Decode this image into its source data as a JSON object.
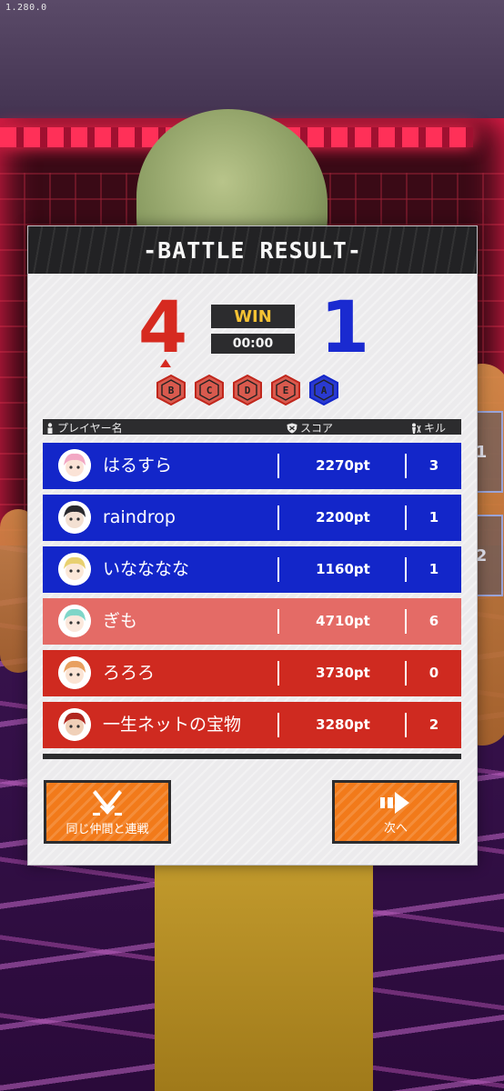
{
  "version": "1.280.0",
  "title": "-BATTLE RESULT-",
  "result": {
    "red_score": "4",
    "blue_score": "1",
    "status": "WIN",
    "time": "00:00"
  },
  "zones": [
    {
      "letter": "B",
      "team": "red"
    },
    {
      "letter": "C",
      "team": "red"
    },
    {
      "letter": "D",
      "team": "red"
    },
    {
      "letter": "E",
      "team": "red"
    },
    {
      "letter": "A",
      "team": "blue"
    }
  ],
  "table_headers": {
    "player": "プレイヤー名",
    "score": "スコア",
    "kills": "キル"
  },
  "players": [
    {
      "name": "はるすら",
      "score": "2270pt",
      "kills": "3",
      "team": "blue",
      "avatar_icon": "pink-hair-avatar-icon"
    },
    {
      "name": "raindrop",
      "score": "2200pt",
      "kills": "1",
      "team": "blue",
      "avatar_icon": "dark-hair-avatar-icon"
    },
    {
      "name": "いなななな",
      "score": "1160pt",
      "kills": "1",
      "team": "blue",
      "avatar_icon": "blonde-hair-avatar-icon"
    },
    {
      "name": "ぎも",
      "score": "4710pt",
      "kills": "6",
      "team": "red-self",
      "avatar_icon": "teal-hair-avatar-icon"
    },
    {
      "name": "ろろろ",
      "score": "3730pt",
      "kills": "0",
      "team": "red",
      "avatar_icon": "orange-hair-avatar-icon"
    },
    {
      "name": "一生ネットの宝物",
      "score": "3280pt",
      "kills": "2",
      "team": "red",
      "avatar_icon": "red-cap-avatar-icon"
    }
  ],
  "buttons": {
    "rematch": "同じ仲間と連戦",
    "next": "次へ"
  },
  "side_tabs": [
    "1",
    "2"
  ],
  "colors": {
    "red_team": "#cf2a20",
    "blue_team": "#1326c9",
    "self_row": "#e46b66",
    "win": "#f5c234",
    "button": "#f27a1a"
  }
}
